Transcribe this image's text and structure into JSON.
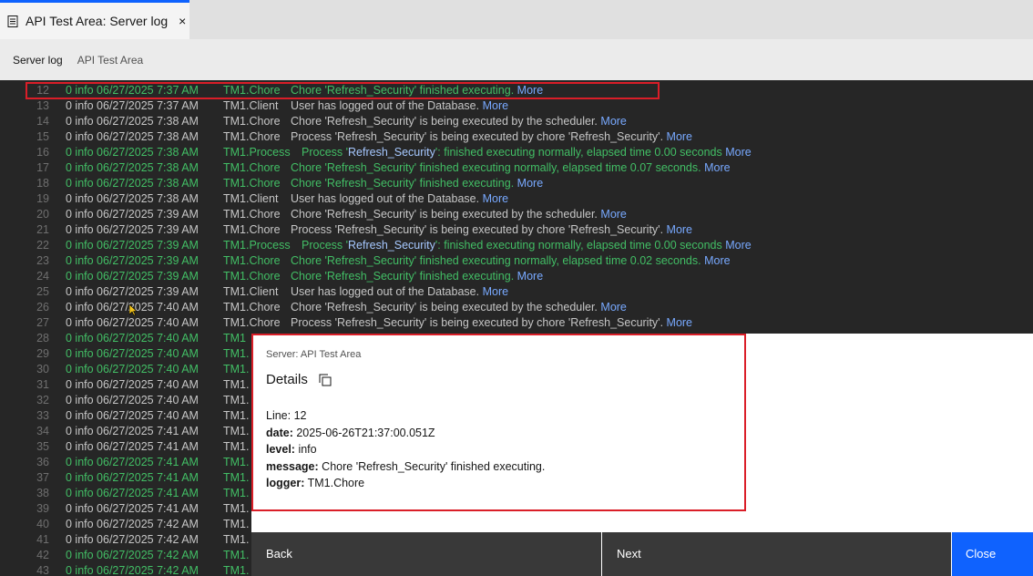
{
  "tab": {
    "title": "API Test Area: Server log",
    "close": "×"
  },
  "breadcrumb": {
    "item1": "Server log",
    "item2": "API Test Area"
  },
  "log_rows": [
    {
      "ln": "12",
      "lvl": "0 info 06/27/2025 7:37 AM",
      "logger": "TM1.Chore",
      "pre": "Chore 'Refresh_Security' finished executing.",
      "hl": "",
      "post": "",
      "color": "green",
      "proc": false
    },
    {
      "ln": "13",
      "lvl": "0 info 06/27/2025 7:37 AM",
      "logger": "TM1.Client",
      "pre": "User has logged out of the Database.",
      "hl": "",
      "post": "",
      "color": "white",
      "proc": false
    },
    {
      "ln": "14",
      "lvl": "0 info 06/27/2025 7:38 AM",
      "logger": "TM1.Chore",
      "pre": "Chore 'Refresh_Security' is being executed by the scheduler.",
      "hl": "",
      "post": "",
      "color": "white",
      "proc": false
    },
    {
      "ln": "15",
      "lvl": "0 info 06/27/2025 7:38 AM",
      "logger": "TM1.Chore",
      "pre": "Process 'Refresh_Security' is being executed by chore 'Refresh_Security'.",
      "hl": "",
      "post": "",
      "color": "white",
      "proc": false
    },
    {
      "ln": "16",
      "lvl": "0 info 06/27/2025 7:38 AM",
      "logger": "TM1.Process",
      "pre": "Process '",
      "hl": "Refresh_Security",
      "post": "': finished executing normally, elapsed time 0.00 seconds",
      "color": "green",
      "proc": true
    },
    {
      "ln": "17",
      "lvl": "0 info 06/27/2025 7:38 AM",
      "logger": "TM1.Chore",
      "pre": "Chore 'Refresh_Security' finished executing normally, elapsed time 0.07 seconds.",
      "hl": "",
      "post": "",
      "color": "green",
      "proc": false
    },
    {
      "ln": "18",
      "lvl": "0 info 06/27/2025 7:38 AM",
      "logger": "TM1.Chore",
      "pre": "Chore 'Refresh_Security' finished executing.",
      "hl": "",
      "post": "",
      "color": "green",
      "proc": false
    },
    {
      "ln": "19",
      "lvl": "0 info 06/27/2025 7:38 AM",
      "logger": "TM1.Client",
      "pre": "User has logged out of the Database.",
      "hl": "",
      "post": "",
      "color": "white",
      "proc": false
    },
    {
      "ln": "20",
      "lvl": "0 info 06/27/2025 7:39 AM",
      "logger": "TM1.Chore",
      "pre": "Chore 'Refresh_Security' is being executed by the scheduler.",
      "hl": "",
      "post": "",
      "color": "white",
      "proc": false
    },
    {
      "ln": "21",
      "lvl": "0 info 06/27/2025 7:39 AM",
      "logger": "TM1.Chore",
      "pre": "Process 'Refresh_Security' is being executed by chore 'Refresh_Security'.",
      "hl": "",
      "post": "",
      "color": "white",
      "proc": false
    },
    {
      "ln": "22",
      "lvl": "0 info 06/27/2025 7:39 AM",
      "logger": "TM1.Process",
      "pre": "Process '",
      "hl": "Refresh_Security",
      "post": "': finished executing normally, elapsed time 0.00 seconds",
      "color": "green",
      "proc": true
    },
    {
      "ln": "23",
      "lvl": "0 info 06/27/2025 7:39 AM",
      "logger": "TM1.Chore",
      "pre": "Chore 'Refresh_Security' finished executing normally, elapsed time 0.02 seconds.",
      "hl": "",
      "post": "",
      "color": "green",
      "proc": false
    },
    {
      "ln": "24",
      "lvl": "0 info 06/27/2025 7:39 AM",
      "logger": "TM1.Chore",
      "pre": "Chore 'Refresh_Security' finished executing.",
      "hl": "",
      "post": "",
      "color": "green",
      "proc": false
    },
    {
      "ln": "25",
      "lvl": "0 info 06/27/2025 7:39 AM",
      "logger": "TM1.Client",
      "pre": "User has logged out of the Database.",
      "hl": "",
      "post": "",
      "color": "white",
      "proc": false
    },
    {
      "ln": "26",
      "lvl": "0 info 06/27/2025 7:40 AM",
      "logger": "TM1.Chore",
      "pre": "Chore 'Refresh_Security' is being executed by the scheduler.",
      "hl": "",
      "post": "",
      "color": "white",
      "proc": false
    },
    {
      "ln": "27",
      "lvl": "0 info 06/27/2025 7:40 AM",
      "logger": "TM1.Chore",
      "pre": "Process 'Refresh_Security' is being executed by chore 'Refresh_Security'.",
      "hl": "",
      "post": "",
      "color": "white",
      "proc": false
    },
    {
      "ln": "28",
      "lvl": "0 info 06/27/2025 7:40 AM",
      "logger": "TM1",
      "pre": "",
      "hl": "",
      "post": "",
      "color": "green",
      "proc": false
    },
    {
      "ln": "29",
      "lvl": "0 info 06/27/2025 7:40 AM",
      "logger": "TM1.",
      "pre": "",
      "hl": "",
      "post": "",
      "color": "green",
      "proc": false
    },
    {
      "ln": "30",
      "lvl": "0 info 06/27/2025 7:40 AM",
      "logger": "TM1.",
      "pre": "",
      "hl": "",
      "post": "",
      "color": "green",
      "proc": false
    },
    {
      "ln": "31",
      "lvl": "0 info 06/27/2025 7:40 AM",
      "logger": "TM1.",
      "pre": "",
      "hl": "",
      "post": "",
      "color": "white",
      "proc": false
    },
    {
      "ln": "32",
      "lvl": "0 info 06/27/2025 7:40 AM",
      "logger": "TM1.",
      "pre": "",
      "hl": "",
      "post": "",
      "color": "white",
      "proc": false
    },
    {
      "ln": "33",
      "lvl": "0 info 06/27/2025 7:40 AM",
      "logger": "TM1.",
      "pre": "",
      "hl": "",
      "post": "",
      "color": "white",
      "proc": false
    },
    {
      "ln": "34",
      "lvl": "0 info 06/27/2025 7:41 AM",
      "logger": "TM1.",
      "pre": "",
      "hl": "",
      "post": "",
      "color": "white",
      "proc": false
    },
    {
      "ln": "35",
      "lvl": "0 info 06/27/2025 7:41 AM",
      "logger": "TM1.",
      "pre": "",
      "hl": "",
      "post": "",
      "color": "white",
      "proc": false
    },
    {
      "ln": "36",
      "lvl": "0 info 06/27/2025 7:41 AM",
      "logger": "TM1.",
      "pre": "",
      "hl": "",
      "post": "",
      "color": "green",
      "proc": false
    },
    {
      "ln": "37",
      "lvl": "0 info 06/27/2025 7:41 AM",
      "logger": "TM1.",
      "pre": "",
      "hl": "",
      "post": "",
      "color": "green",
      "proc": false
    },
    {
      "ln": "38",
      "lvl": "0 info 06/27/2025 7:41 AM",
      "logger": "TM1.",
      "pre": "",
      "hl": "",
      "post": "",
      "color": "green",
      "proc": false
    },
    {
      "ln": "39",
      "lvl": "0 info 06/27/2025 7:41 AM",
      "logger": "TM1.",
      "pre": "",
      "hl": "",
      "post": "",
      "color": "white",
      "proc": false
    },
    {
      "ln": "40",
      "lvl": "0 info 06/27/2025 7:42 AM",
      "logger": "TM1.",
      "pre": "",
      "hl": "",
      "post": "",
      "color": "white",
      "proc": false
    },
    {
      "ln": "41",
      "lvl": "0 info 06/27/2025 7:42 AM",
      "logger": "TM1.",
      "pre": "",
      "hl": "",
      "post": "",
      "color": "white",
      "proc": false
    },
    {
      "ln": "42",
      "lvl": "0 info 06/27/2025 7:42 AM",
      "logger": "TM1.",
      "pre": "",
      "hl": "",
      "post": "",
      "color": "green",
      "proc": false
    },
    {
      "ln": "43",
      "lvl": "0 info 06/27/2025 7:42 AM",
      "logger": "TM1.",
      "pre": "",
      "hl": "",
      "post": "",
      "color": "green",
      "proc": false
    }
  ],
  "more_label": "More",
  "details": {
    "server": "Server: API Test Area",
    "title": "Details",
    "line_label": "Line:",
    "line_value": "12",
    "date_label": "date:",
    "date_value": "2025-06-26T21:37:00.051Z",
    "level_label": "level:",
    "level_value": "info",
    "message_label": "message:",
    "message_value": "Chore 'Refresh_Security' finished executing.",
    "logger_label": "logger:",
    "logger_value": "TM1.Chore"
  },
  "buttons": {
    "back": "Back",
    "next": "Next",
    "close": "Close"
  },
  "colors": {
    "accent": "#0f62fe",
    "log_bg": "#262626",
    "green": "#42be65",
    "link": "#78a9ff",
    "highlight_red": "#da1e28"
  }
}
